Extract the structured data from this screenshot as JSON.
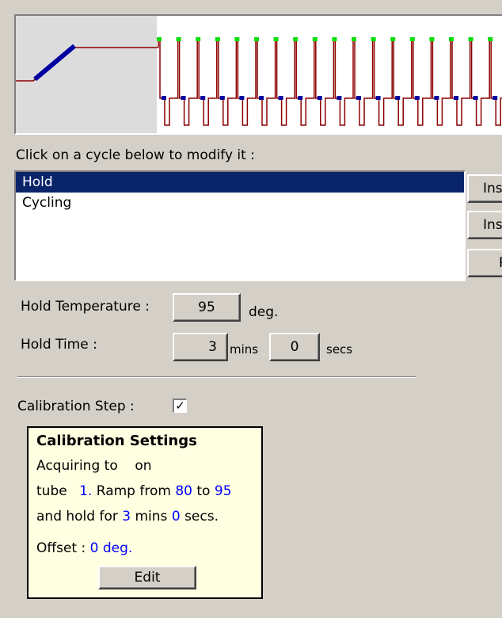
{
  "colors": {
    "selection": "#0a246a",
    "profile_line": "#8b0000",
    "profile_marker_top": "#00e000",
    "profile_marker_bottom": "#0000a0",
    "calibration_values": "#0000ff"
  },
  "instruction_label": "Click on a cycle below to modify it :",
  "cycles": [
    {
      "label": "Hold",
      "selected": true
    },
    {
      "label": "Cycling",
      "selected": false
    }
  ],
  "side_buttons": [
    "Ins",
    "Inse",
    "R"
  ],
  "hold": {
    "temperature_label": "Hold Temperature :",
    "temperature_value": "95",
    "temperature_unit": "deg.",
    "time_label": "Hold Time :",
    "minutes_value": "3",
    "minutes_unit": "mins",
    "seconds_value": "0",
    "seconds_unit": "secs"
  },
  "calibration": {
    "step_label": "Calibration Step :",
    "checked": true,
    "check_glyph": "✓",
    "box": {
      "title": "Calibration Settings",
      "line1": "Acquiring to    on",
      "line2_a": "tube",
      "tube": "1.",
      "line2_b": "Ramp from",
      "ramp_from": "80",
      "line2_c": "to",
      "ramp_to": "95",
      "line3_a": "and hold for",
      "hold_mins": "3",
      "line3_b": "mins",
      "hold_secs": "0",
      "line3_c": "secs.",
      "offset_label": "Offset :",
      "offset_value": "0 deg.",
      "edit_label": "Edit"
    }
  }
}
